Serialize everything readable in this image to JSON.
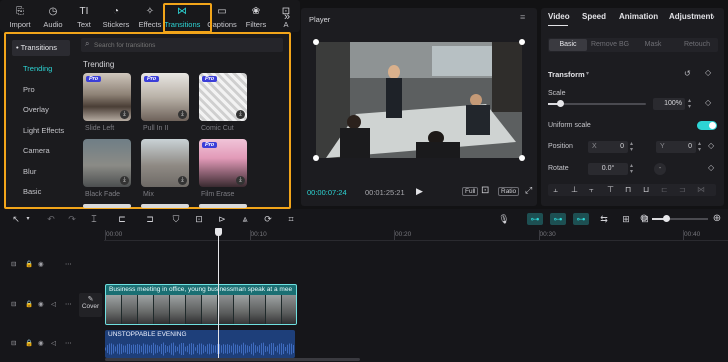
{
  "toolbar": {
    "items": [
      {
        "label": "Import",
        "icon": "import-icon",
        "glyph": "⎘"
      },
      {
        "label": "Audio",
        "icon": "audio-icon",
        "glyph": "◷"
      },
      {
        "label": "Text",
        "icon": "text-icon",
        "glyph": "TI"
      },
      {
        "label": "Stickers",
        "icon": "stickers-icon",
        "glyph": "◔"
      },
      {
        "label": "Effects",
        "icon": "effects-icon",
        "glyph": "✧"
      },
      {
        "label": "Transitions",
        "icon": "transitions-icon",
        "glyph": "⋈"
      },
      {
        "label": "Captions",
        "icon": "captions-icon",
        "glyph": "▭"
      },
      {
        "label": "Filters",
        "icon": "filters-icon",
        "glyph": "❀"
      },
      {
        "label": "A",
        "icon": "adjust-icon",
        "glyph": "⊡"
      }
    ],
    "more": "»"
  },
  "sidebar": {
    "header": "• Transitions",
    "items": [
      "Trending",
      "Pro",
      "Overlay",
      "Light Effects",
      "Camera",
      "Blur",
      "Basic"
    ]
  },
  "search": {
    "placeholder": "Search for transitions"
  },
  "trending": {
    "title": "Trending",
    "items": [
      {
        "label": "Slide Left",
        "pro": "Pro"
      },
      {
        "label": "Pull In II",
        "pro": "Pro"
      },
      {
        "label": "Comic Cut",
        "pro": "Pro"
      },
      {
        "label": "Black Fade",
        "pro": ""
      },
      {
        "label": "Mix",
        "pro": ""
      },
      {
        "label": "Film Erase",
        "pro": "Pro"
      }
    ]
  },
  "player": {
    "title": "Player",
    "current_time": "00:00:07:24",
    "total_time": "00:01:25:21",
    "full_label": "Full",
    "ratio_label": "Ratio"
  },
  "inspector": {
    "tabs": [
      "Video",
      "Speed",
      "Animation",
      "Adjustment"
    ],
    "subtabs": [
      "Basic",
      "Remove BG",
      "Mask",
      "Retouch"
    ],
    "transform_title": "Transform",
    "scale_label": "Scale",
    "scale_value": "100%",
    "scale_level": 0.12,
    "uniform_scale_label": "Uniform scale",
    "position_label": "Position",
    "pos_x_label": "X",
    "pos_x_value": "0",
    "pos_y_label": "Y",
    "pos_y_value": "0",
    "rotate_label": "Rotate",
    "rotate_value": "0.0°",
    "rotate_dash": "-"
  },
  "timeline": {
    "ticks": [
      "00:00",
      "00:10",
      "00:20",
      "00:30",
      "00:40"
    ],
    "video_clip_label": "Business meeting in office, young businessman speak at a mee",
    "cover_label": "Cover",
    "audio_clip_label": "UNSTOPPABLE EVENING"
  },
  "colors": {
    "accent": "#2dd4d4",
    "highlight": "#f2a51a",
    "video_clip": "#1a6f73",
    "audio_clip": "#1e3f7a"
  }
}
